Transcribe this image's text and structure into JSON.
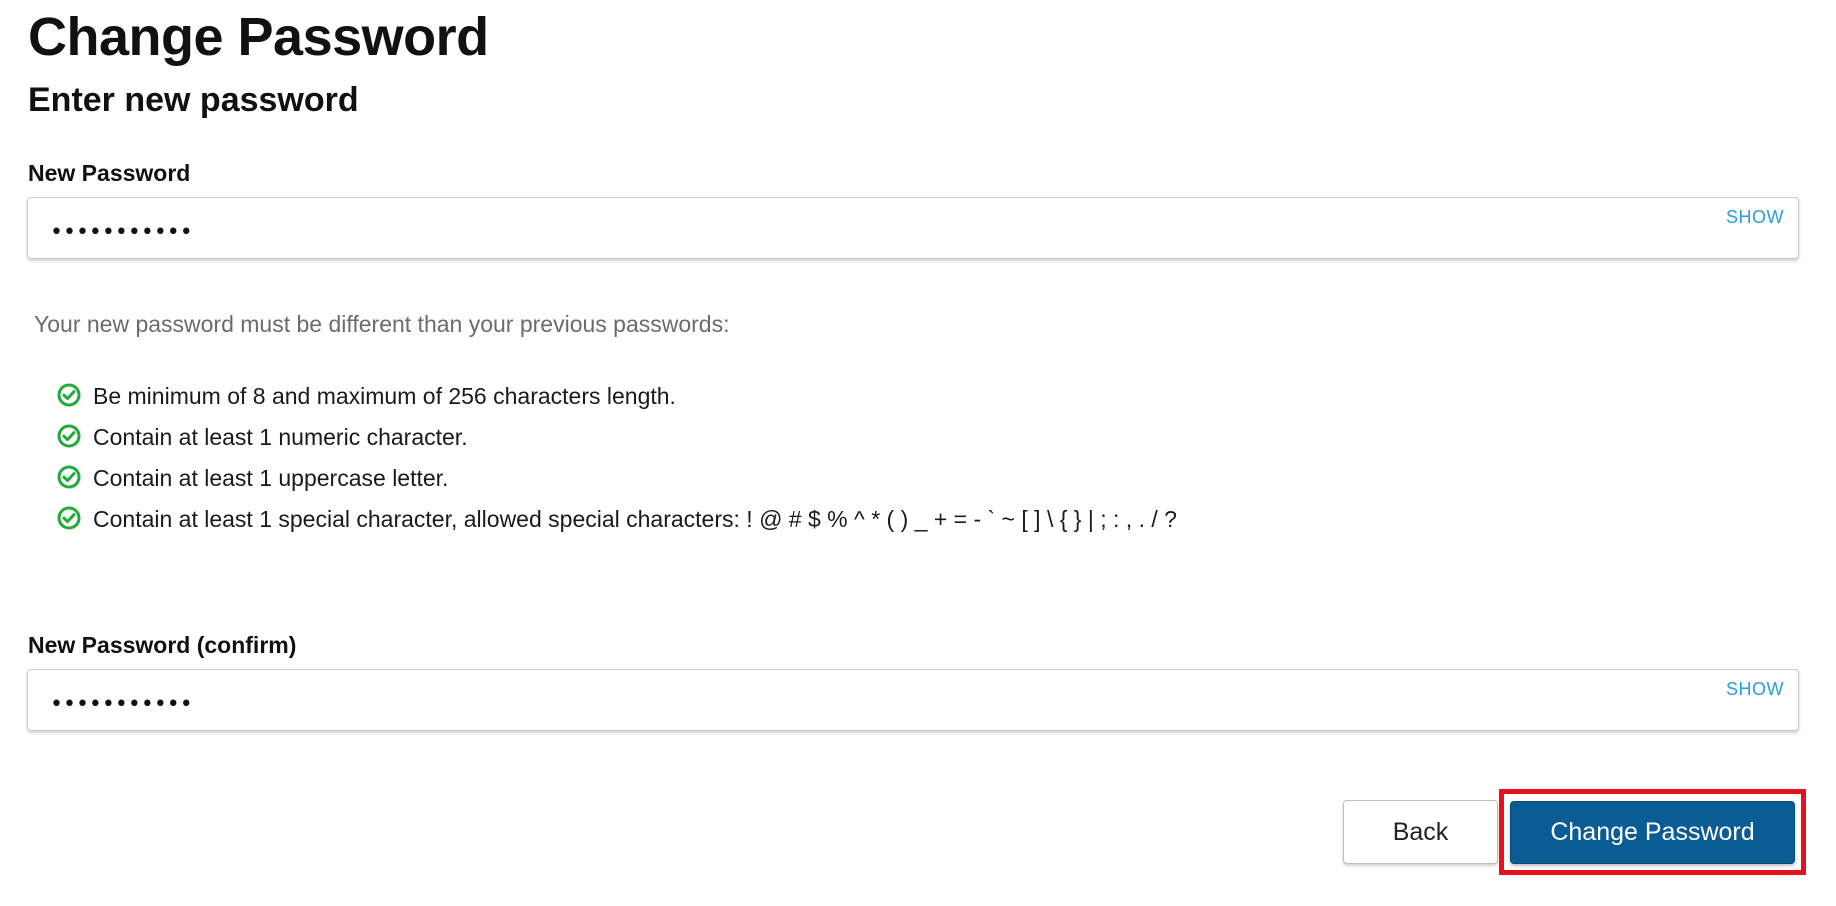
{
  "page": {
    "title": "Change Password",
    "subtitle": "Enter new password"
  },
  "new_password": {
    "label": "New Password",
    "value": "•••••••••••",
    "show_label": "SHOW"
  },
  "requirements": {
    "intro": "Your new password must be different than your previous passwords:",
    "items": [
      {
        "text": "Be minimum of 8 and maximum of 256 characters length.",
        "icon": "check-circle-icon",
        "satisfied": true
      },
      {
        "text": "Contain at least 1 numeric character.",
        "icon": "check-circle-icon",
        "satisfied": true
      },
      {
        "text": "Contain at least 1 uppercase letter.",
        "icon": "check-circle-icon",
        "satisfied": true
      },
      {
        "text": "Contain at least 1 special character, allowed special characters: ! @ # $ % ^ * ( ) _ + = - ` ~ [ ] \\ { } | ; : , . / ?",
        "icon": "check-circle-icon",
        "satisfied": true
      }
    ]
  },
  "confirm_password": {
    "label": "New Password (confirm)",
    "value": "•••••••••••",
    "show_label": "SHOW"
  },
  "actions": {
    "back_label": "Back",
    "submit_label": "Change Password"
  },
  "colors": {
    "primary": "#0a5c94",
    "link": "#2a9fd6",
    "check": "#1faa3a",
    "highlight": "#e8101c"
  }
}
